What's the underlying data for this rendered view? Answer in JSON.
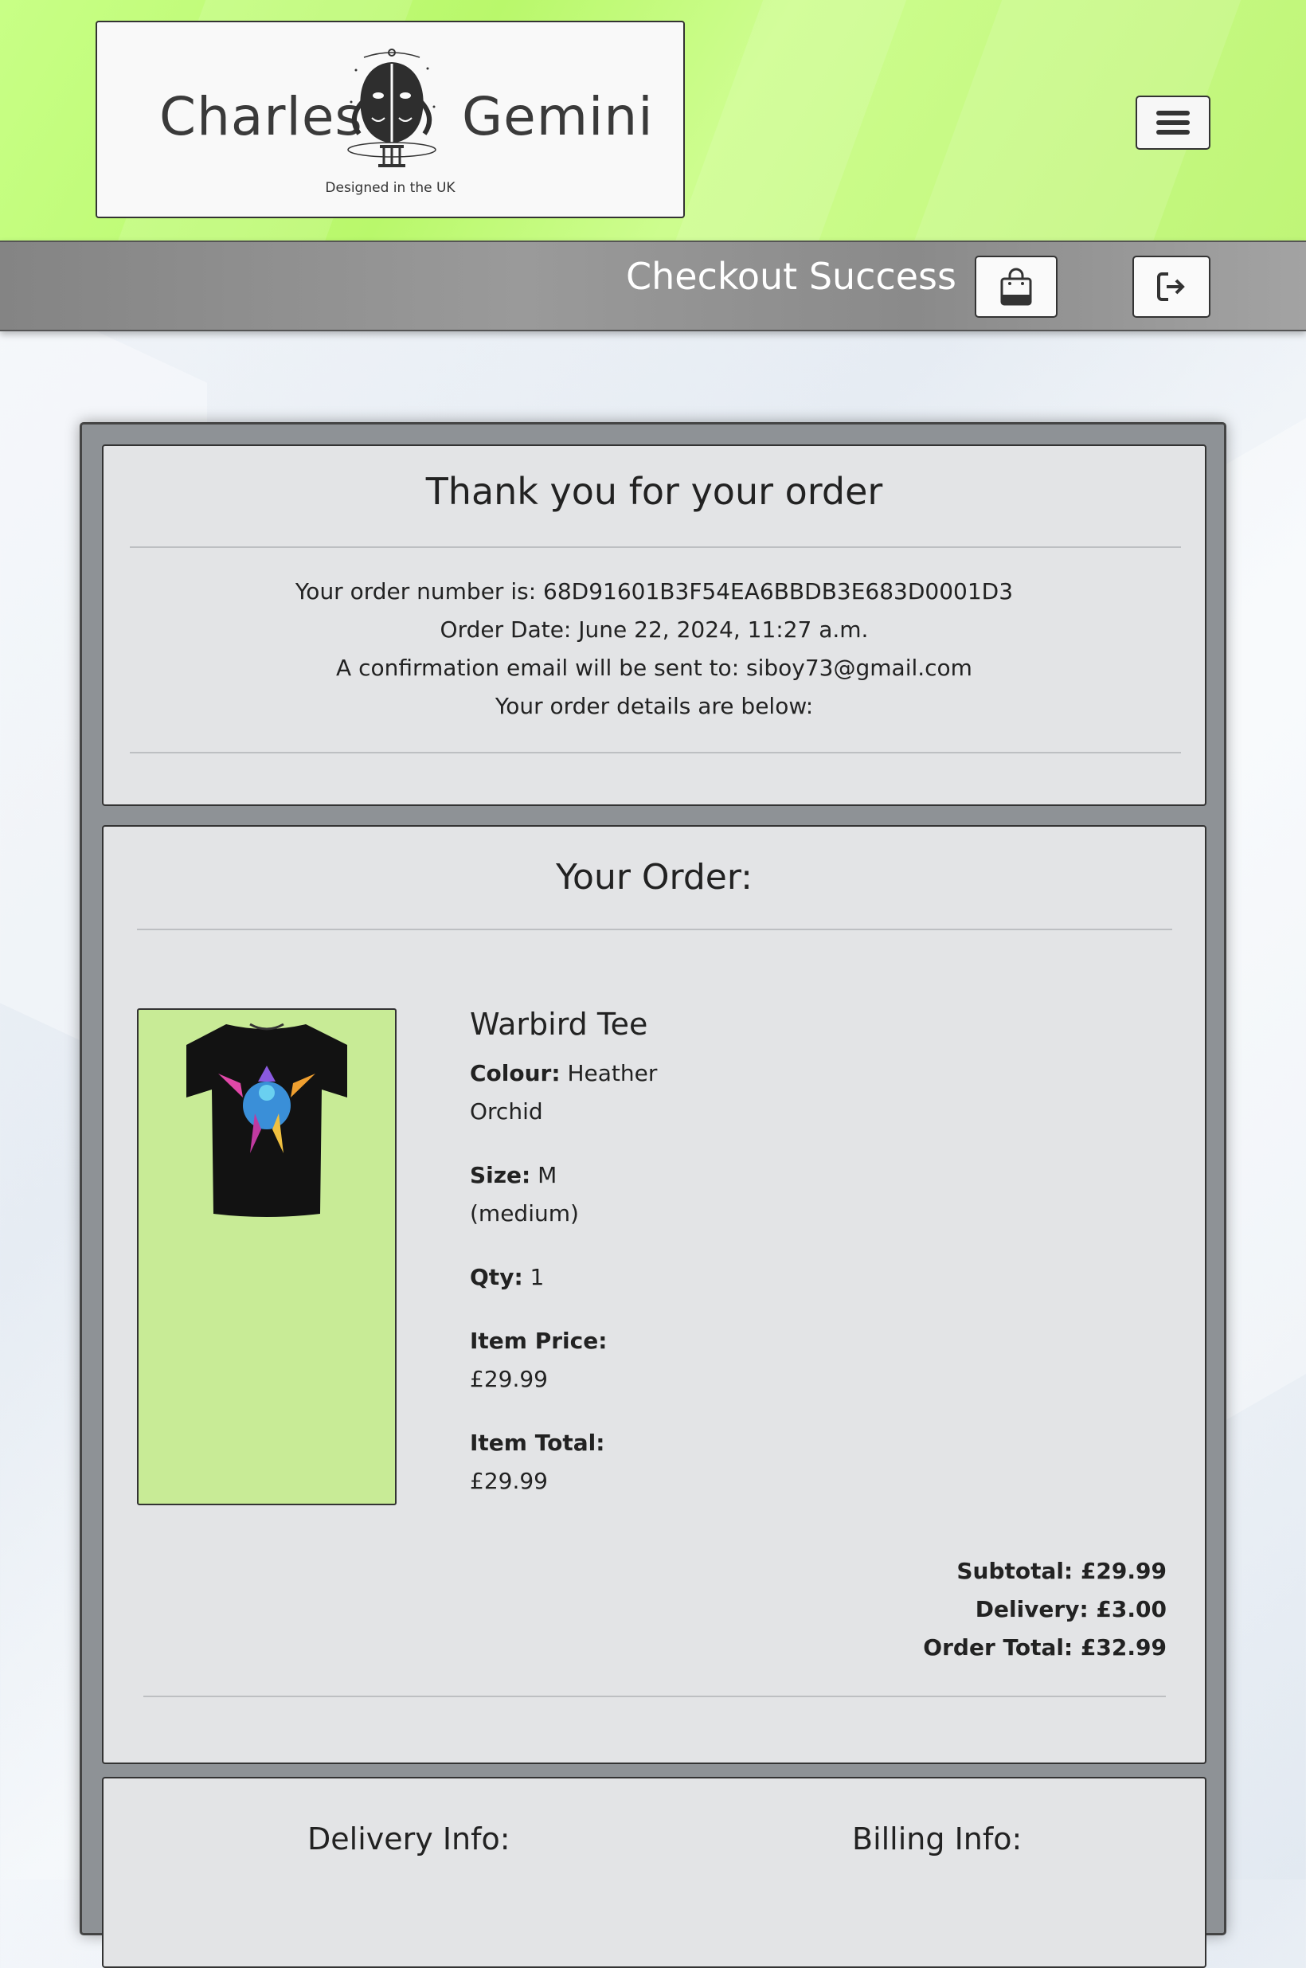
{
  "brand": {
    "name_left": "Charles",
    "name_right": "Gemini",
    "tagline": "Designed in the UK"
  },
  "nav": {
    "title": "Checkout Success",
    "menu_icon": "hamburger-icon",
    "bag_icon": "shopping-bag-icon",
    "logout_icon": "sign-out-icon"
  },
  "confirmation": {
    "heading": "Thank you for your order",
    "order_number": "Your order number is: 68D91601B3F54EA6BBDB3E683D0001D3",
    "order_date": "Order Date: June 22, 2024, 11:27 a.m.",
    "email_line": "A confirmation email will be sent to: siboy73@gmail.com",
    "details_line": "Your order details are below:"
  },
  "order": {
    "heading": "Your Order:",
    "item": {
      "name": "Warbird Tee",
      "colour_label": "Colour:",
      "colour_value_1": "Heather",
      "colour_value_2": "Orchid",
      "size_label": "Size:",
      "size_value_1": "M",
      "size_value_2": "(medium)",
      "qty_label": "Qty:",
      "qty_value": "1",
      "price_label": "Item Price:",
      "price_value": "£29.99",
      "total_label": "Item Total:",
      "total_value": "£29.99"
    },
    "subtotal": "Subtotal: £29.99",
    "delivery": "Delivery: £3.00",
    "order_total": "Order Total: £32.99"
  },
  "info": {
    "delivery_heading": "Delivery Info:",
    "billing_heading": "Billing Info:"
  },
  "colors": {
    "header_green": "#c3fc7b",
    "product_bg": "#c8eb96"
  }
}
